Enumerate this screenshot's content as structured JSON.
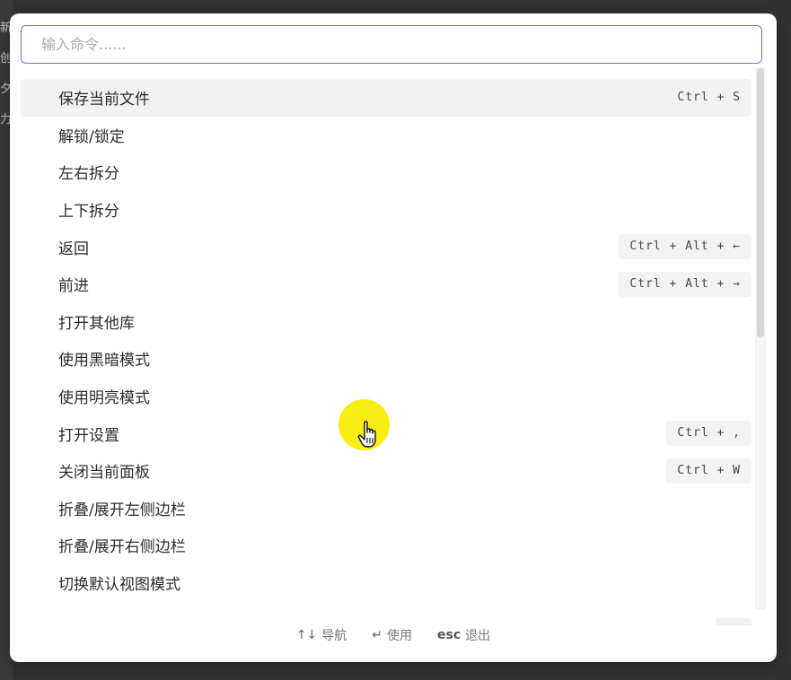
{
  "background": {
    "sidebar_chars": [
      "新",
      "创",
      "夕",
      "力"
    ]
  },
  "search": {
    "placeholder": "输入命令......",
    "value": ""
  },
  "commands": [
    {
      "label": "保存当前文件",
      "hotkey": "Ctrl + S",
      "selected": true
    },
    {
      "label": "解锁/锁定",
      "hotkey": ""
    },
    {
      "label": "左右拆分",
      "hotkey": ""
    },
    {
      "label": "上下拆分",
      "hotkey": ""
    },
    {
      "label": "返回",
      "hotkey": "Ctrl + Alt + ←"
    },
    {
      "label": "前进",
      "hotkey": "Ctrl + Alt + →"
    },
    {
      "label": "打开其他库",
      "hotkey": ""
    },
    {
      "label": "使用黑暗模式",
      "hotkey": ""
    },
    {
      "label": "使用明亮模式",
      "hotkey": ""
    },
    {
      "label": "打开设置",
      "hotkey": "Ctrl + ,"
    },
    {
      "label": "关闭当前面板",
      "hotkey": "Ctrl + W"
    },
    {
      "label": "折叠/展开左侧边栏",
      "hotkey": ""
    },
    {
      "label": "折叠/展开右侧边栏",
      "hotkey": ""
    },
    {
      "label": "切换默认视图模式",
      "hotkey": ""
    }
  ],
  "footer": {
    "navigate_key": "↑↓",
    "navigate_label": "导航",
    "use_key": "↵",
    "use_label": "使用",
    "exit_key": "esc",
    "exit_label": "退出"
  },
  "colors": {
    "accent": "#7b6bd6",
    "selected_row": "#f2f2f2",
    "hotkey_bg": "#f3f3f3",
    "cursor_highlight": "#f8ec00"
  },
  "icons": {
    "cursor": "hand-pointer-icon"
  }
}
